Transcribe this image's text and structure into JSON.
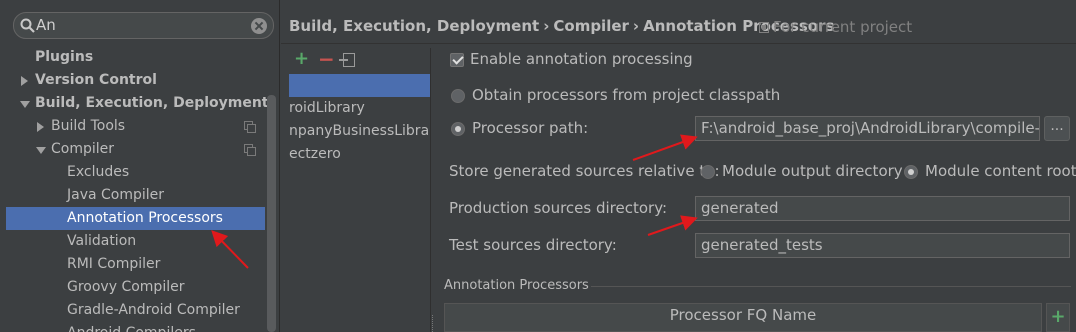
{
  "search": {
    "value": "An"
  },
  "tree": [
    {
      "label": "Plugins",
      "bold": true
    },
    {
      "label": "Version Control",
      "bold": true,
      "arrow": "right"
    },
    {
      "label": "Build, Execution, Deployment",
      "bold": true,
      "arrow": "down"
    },
    {
      "label": "Build Tools",
      "arrow": "right"
    },
    {
      "label": "Compiler",
      "arrow": "down"
    },
    {
      "label": "Excludes"
    },
    {
      "label": "Java Compiler"
    },
    {
      "label": "Annotation Processors",
      "selected": true
    },
    {
      "label": "Validation"
    },
    {
      "label": "RMI Compiler"
    },
    {
      "label": "Groovy Compiler"
    },
    {
      "label": "Gradle-Android Compiler"
    },
    {
      "label": "Android Compilers"
    }
  ],
  "breadcrumb": {
    "part1": "Build, Execution, Deployment",
    "part2": "Compiler",
    "part3": "Annotation Processors",
    "separator": "›",
    "scope": "For current project"
  },
  "profiles": {
    "add_symbol": "+",
    "remove_symbol": "−",
    "items": [
      "",
      "roidLibrary",
      "npanyBusinessLibrary",
      "ectzero"
    ]
  },
  "form": {
    "enable_label": "Enable annotation processing",
    "obtain_label": "Obtain processors from project classpath",
    "processor_path_label": "Processor path:",
    "processor_path_value": "F:\\android_base_proj\\AndroidLibrary\\compile-libs\\a",
    "browse_label": "...",
    "store_label": "Store generated sources relative to:",
    "module_output_label": "Module output directory",
    "module_content_label": "Module content root",
    "production_label": "Production sources directory:",
    "production_value": "generated",
    "test_label": "Test sources directory:",
    "test_value": "generated_tests"
  },
  "annotation_processors": {
    "section_title": "Annotation Processors",
    "column_header": "Processor FQ Name",
    "add_symbol": "+"
  },
  "colors": {
    "background": "#3c3f41",
    "selection": "#4b6eaf",
    "annotation_arrow": "#e0191c",
    "add_green": "#59a869",
    "remove_red": "#c75450"
  },
  "icons": {
    "search": "search-icon",
    "clear": "clear-icon",
    "copy": "copy-settings-icon",
    "project_scope": "project-scope-icon",
    "move": "move-profile-icon"
  }
}
